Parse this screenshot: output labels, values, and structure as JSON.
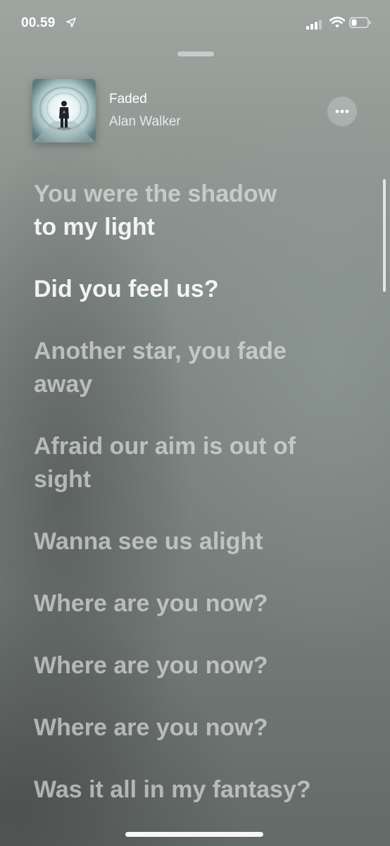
{
  "status_bar": {
    "time": "00.59",
    "icons": [
      "location-arrow-icon",
      "cellular-signal-icon",
      "wifi-icon",
      "battery-icon"
    ]
  },
  "now_playing": {
    "title": "Faded",
    "artist": "Alan Walker",
    "artwork": "album-artwork",
    "more_icon": "ellipsis-icon"
  },
  "lyrics": [
    {
      "text_part1": "You were the shadow",
      "text_part2": "to my light"
    },
    {
      "text": "Did you feel us?"
    },
    {
      "text": "Another star, you fade away"
    },
    {
      "text": "Afraid our aim is out of sight"
    },
    {
      "text": "Wanna see us alight"
    },
    {
      "text": "Where are you now?"
    },
    {
      "text": "Where are you now?"
    },
    {
      "text": "Where are you now?"
    },
    {
      "text": "Was it all in my fantasy?"
    }
  ],
  "colors": {
    "text": "#ffffff",
    "background_top": "#9fa6a2",
    "background_bottom": "#646a67"
  }
}
